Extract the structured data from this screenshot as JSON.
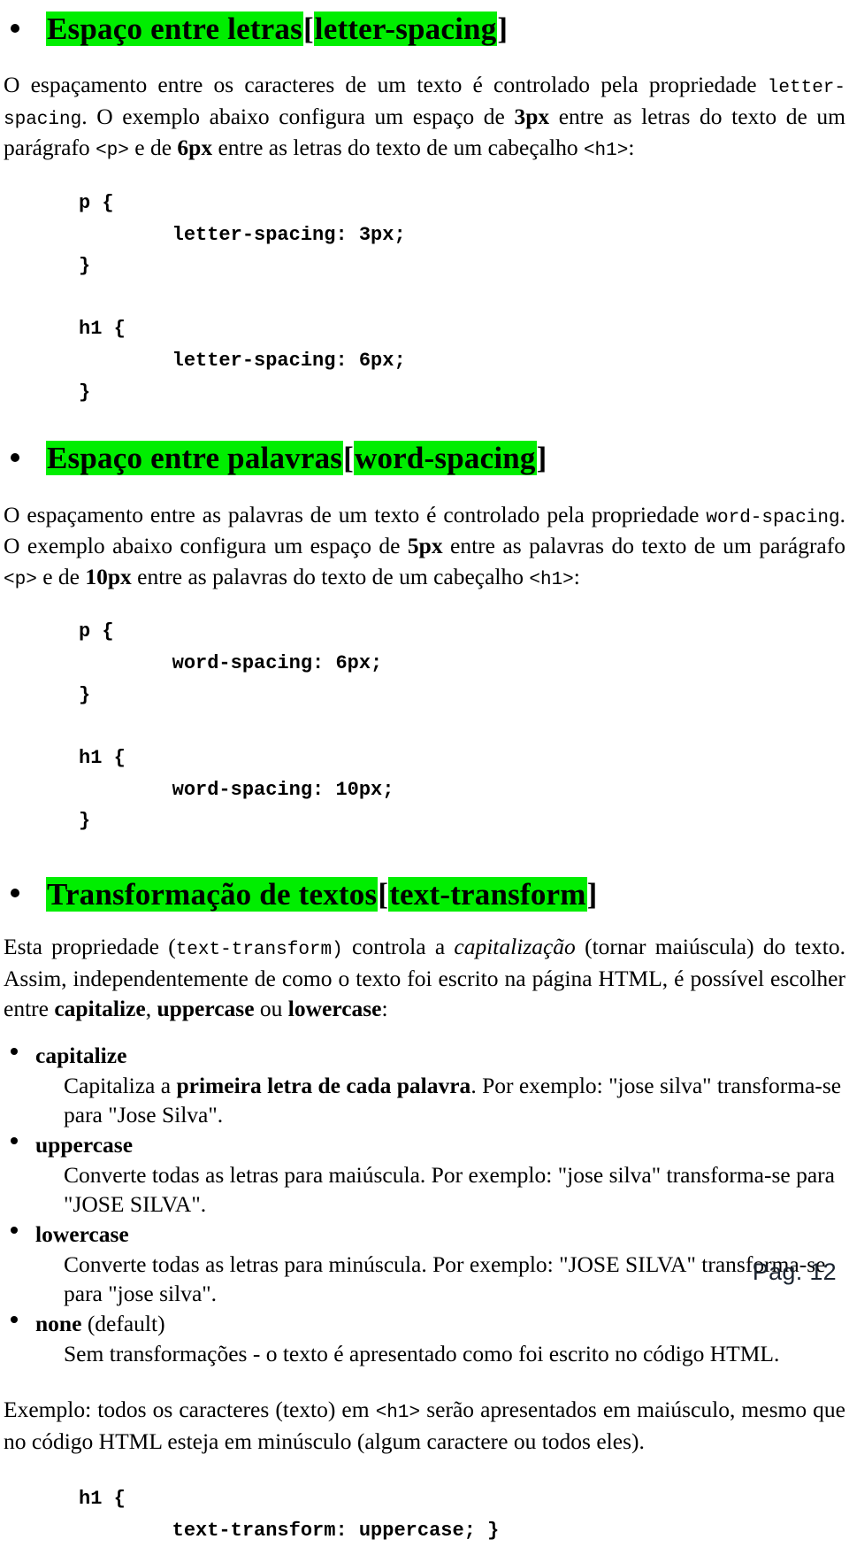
{
  "document": {
    "page_label": "Pag. 12",
    "highlight_color": "#00ee00",
    "text_color": "#000000",
    "background_color": "#ffffff"
  },
  "sections": [
    {
      "heading": {
        "title": "Espaço entre letras",
        "open_bracket": "[",
        "property": "letter-spacing",
        "close_bracket": "]"
      },
      "paragraph": {
        "part1": "O espaçamento entre os caracteres de um texto é controlado pela propriedade ",
        "code1": "letter-spacing",
        "part2": ". O exemplo abaixo configura um espaço de ",
        "bold1": "3px",
        "part3": " entre as letras do texto de um parágrafo ",
        "code2": "<p>",
        "part4": " e de ",
        "bold2": "6px",
        "part5": " entre as letras do texto de um cabeçalho ",
        "code3": "<h1>",
        "part6": ":"
      },
      "code_block": "p {\n        letter-spacing: 3px;\n}\n\nh1 {\n        letter-spacing: 6px;\n}"
    },
    {
      "heading": {
        "title": "Espaço entre palavras",
        "open_bracket": "[",
        "property": "word-spacing",
        "close_bracket": "]"
      },
      "paragraph": {
        "part1": "O espaçamento entre as palavras de um texto é controlado pela propriedade ",
        "code1": "word-spacing",
        "part2": ". O exemplo abaixo configura um espaço de ",
        "bold1": "5px",
        "part3": " entre as palavras do texto de um parágrafo ",
        "code2": "<p>",
        "part4": " e de ",
        "bold2": "10px",
        "part5": " entre as palavras do texto de um cabeçalho ",
        "code3": "<h1>",
        "part6": ":"
      },
      "code_block": "p {\n        word-spacing: 6px;\n}\n\nh1 {\n        word-spacing: 10px;\n}"
    }
  ],
  "transform_section": {
    "heading": {
      "title": "Transformação de textos",
      "open_bracket": "[",
      "property": "text-transform",
      "close_bracket": "]"
    },
    "intro": {
      "part1": "Esta propriedade (",
      "code1": "text-transform)",
      "part2": "  controla a ",
      "italic1": "capitalização",
      "part3": " (tornar maiúscula) do texto. Assim, independentemente de como o texto foi escrito na página HTML, é possível escolher entre ",
      "bold1": "capitalize",
      "part4": ", ",
      "bold2": "uppercase",
      "part5": " ou ",
      "bold3": "lowercase",
      "part6": ":"
    },
    "values": [
      {
        "term": "capitalize",
        "term_suffix": "",
        "desc_part1": "Capitaliza a ",
        "desc_bold": "primeira letra de cada palavra",
        "desc_part2": ". Por exemplo: \"jose silva\" transforma-se para \"Jose Silva\"."
      },
      {
        "term": "uppercase",
        "term_suffix": "",
        "desc_part1": "Converte todas as letras para maiúscula. Por exemplo: \"jose silva\" transforma-se para \"JOSE SILVA\".",
        "desc_bold": "",
        "desc_part2": ""
      },
      {
        "term": "lowercase",
        "term_suffix": "",
        "desc_part1": "Converte todas as letras para minúscula. Por exemplo: \"JOSE SILVA\" transforma-se para \"jose silva\".",
        "desc_bold": "",
        "desc_part2": ""
      },
      {
        "term": "none",
        "term_suffix": " (default)",
        "desc_part1": "Sem transformações - o texto é apresentado como foi escrito no código HTML.",
        "desc_bold": "",
        "desc_part2": ""
      }
    ],
    "example_paragraph": {
      "part1": "Exemplo: todos os caracteres (texto) em ",
      "code1": "<h1>",
      "part2": " serão apresentados em maiúsculo, mesmo que no código HTML esteja em minúsculo (algum caractere ou todos eles)."
    },
    "code_block": "h1 {\n        text-transform: uppercase; }"
  }
}
